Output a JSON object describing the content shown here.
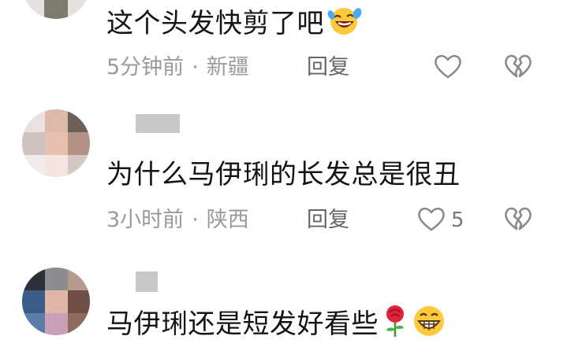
{
  "comments": [
    {
      "text": "这个头发快剪了吧",
      "emoji": "laughing-tears",
      "time": "5分钟前",
      "location": "新疆",
      "separator": "·",
      "reply_label": "回复",
      "like_count": ""
    },
    {
      "text": "为什么马伊琍的长发总是很丑",
      "emoji": "",
      "time": "3小时前",
      "location": "陕西",
      "separator": "·",
      "reply_label": "回复",
      "like_count": "5"
    },
    {
      "text": "马伊琍还是短发好看些",
      "emoji": "rose, grinning-face",
      "time": "",
      "location": "",
      "separator": "",
      "reply_label": "",
      "like_count": ""
    }
  ],
  "colors": {
    "text": "#141414",
    "meta": "#9a9a9a",
    "reply": "#666666",
    "icon_stroke": "#8a8a8a",
    "emoji_yellow": "#ffc93c",
    "rose_red": "#e0243c"
  }
}
